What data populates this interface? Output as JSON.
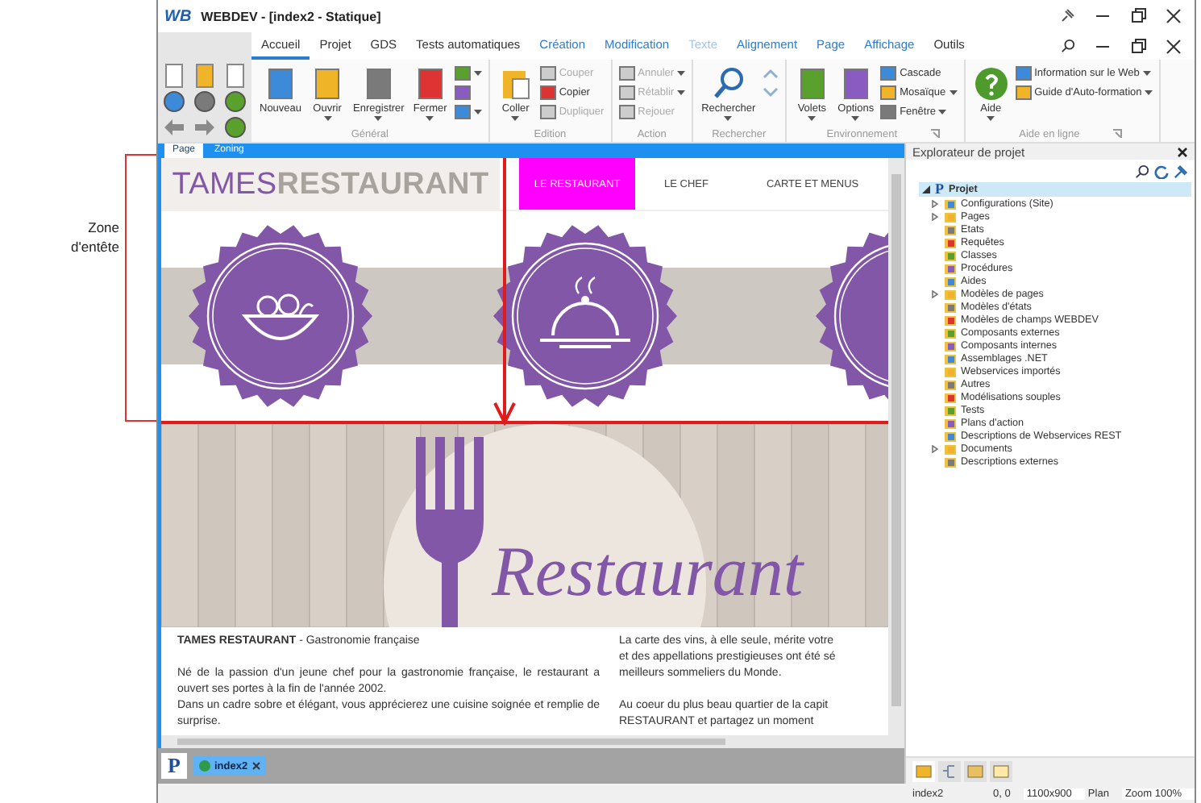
{
  "annotation": {
    "label": "Zone d'entête"
  },
  "window": {
    "logo": "WB",
    "title": "WEBDEV - [index2 - Statique]"
  },
  "ribbon_tabs": [
    {
      "label": "Accueil",
      "kind": "standard",
      "selected": true,
      "disabled": false
    },
    {
      "label": "Projet",
      "kind": "standard",
      "selected": false,
      "disabled": false
    },
    {
      "label": "GDS",
      "kind": "standard",
      "selected": false,
      "disabled": false
    },
    {
      "label": "Tests automatiques",
      "kind": "standard",
      "selected": false,
      "disabled": false
    },
    {
      "label": "Création",
      "kind": "contextual",
      "selected": false,
      "disabled": false
    },
    {
      "label": "Modification",
      "kind": "contextual",
      "selected": false,
      "disabled": false
    },
    {
      "label": "Texte",
      "kind": "contextual",
      "selected": false,
      "disabled": true
    },
    {
      "label": "Alignement",
      "kind": "contextual",
      "selected": false,
      "disabled": false
    },
    {
      "label": "Page",
      "kind": "contextual",
      "selected": false,
      "disabled": false
    },
    {
      "label": "Affichage",
      "kind": "contextual",
      "selected": false,
      "disabled": false
    },
    {
      "label": "Outils",
      "kind": "standard",
      "selected": false,
      "disabled": false
    }
  ],
  "ribbon_groups": [
    {
      "label": "Général",
      "launcher": false,
      "items": [
        {
          "kind": "large",
          "label": "Nouveau",
          "menu": false,
          "disabled": false
        },
        {
          "kind": "large",
          "label": "Ouvrir",
          "menu": true,
          "disabled": false
        },
        {
          "kind": "large",
          "label": "Enregistrer",
          "menu": true,
          "disabled": false
        },
        {
          "kind": "large",
          "label": "Fermer",
          "menu": true,
          "disabled": false
        },
        {
          "kind": "small",
          "menu": true,
          "disabled": false
        },
        {
          "kind": "small",
          "menu": false,
          "disabled": false
        },
        {
          "kind": "small",
          "menu": true,
          "disabled": false
        }
      ]
    },
    {
      "label": "Edition",
      "launcher": false,
      "items": [
        {
          "kind": "large",
          "label": "Coller",
          "menu": true,
          "disabled": false
        },
        {
          "kind": "small",
          "label": "Couper",
          "menu": false,
          "disabled": true
        },
        {
          "kind": "small",
          "label": "Copier",
          "menu": false,
          "disabled": false
        },
        {
          "kind": "small",
          "label": "Dupliquer",
          "menu": false,
          "disabled": true
        }
      ]
    },
    {
      "label": "Action",
      "launcher": false,
      "items": [
        {
          "kind": "small",
          "label": "Annuler",
          "menu": true,
          "disabled": true
        },
        {
          "kind": "small",
          "label": "Rétablir",
          "menu": true,
          "disabled": true
        },
        {
          "kind": "small",
          "label": "Rejouer",
          "menu": false,
          "disabled": true
        }
      ]
    },
    {
      "label": "Rechercher",
      "launcher": false,
      "items": [
        {
          "kind": "large",
          "label": "Rechercher",
          "menu": true,
          "disabled": false
        },
        {
          "kind": "small",
          "menu": false,
          "disabled": false
        },
        {
          "kind": "small",
          "menu": false,
          "disabled": false
        }
      ]
    },
    {
      "label": "Environnement",
      "launcher": true,
      "items": [
        {
          "kind": "large",
          "label": "Volets",
          "menu": true,
          "disabled": false
        },
        {
          "kind": "large",
          "label": "Options",
          "menu": true,
          "disabled": false
        },
        {
          "kind": "small",
          "label": "Cascade",
          "menu": false,
          "disabled": false
        },
        {
          "kind": "small",
          "label": "Mosaïque",
          "menu": true,
          "disabled": false
        },
        {
          "kind": "small",
          "label": "Fenêtre",
          "menu": true,
          "disabled": false
        }
      ]
    },
    {
      "label": "Aide en ligne",
      "launcher": true,
      "items": [
        {
          "kind": "large",
          "label": "Aide",
          "menu": true,
          "disabled": false
        },
        {
          "kind": "small",
          "label": "Information sur le Web",
          "menu": true,
          "disabled": false
        },
        {
          "kind": "small",
          "label": "Guide d'Auto-formation",
          "menu": true,
          "disabled": false
        }
      ]
    }
  ],
  "editor_tabs": [
    {
      "label": "Page",
      "selected": true
    },
    {
      "label": "Zoning",
      "selected": false
    }
  ],
  "page_preview": {
    "logo": [
      "TAMES",
      "RESTAURANT"
    ],
    "menu": [
      {
        "label": "LE RESTAURANT",
        "selected": true
      },
      {
        "label": "LE CHEF",
        "selected": false
      },
      {
        "label": "CARTE ET MENUS",
        "selected": false
      }
    ],
    "hero_title": "Restaurant",
    "column_1": [
      "**TAMES RESTAURANT** - Gastronomie française",
      "Né de la passion d'un jeune chef pour la gastronomie française, le restaurant a ouvert ses portes à la fin de l'année 2002.",
      "Dans un cadre sobre et élégant, vous apprécierez une cuisine soignée et remplie de surprise."
    ],
    "column_2": [
      {
        "lines": [
          "La carte des vins, à elle seule, mérite votre",
          "et des appellations prestigieuses ont été sé",
          "meilleurs sommeliers du Monde."
        ]
      },
      {
        "lines": [
          "Au coeur du plus beau quartier de la capit",
          "RESTAURANT et partagez un moment"
        ]
      }
    ]
  },
  "doc_tabs": {
    "project_button": "P",
    "tabs": [
      {
        "label": "index2",
        "selected": true
      }
    ]
  },
  "explorer": {
    "title": "Explorateur de projet",
    "root": {
      "icon_letter": "P",
      "label": "Projet",
      "expanded": true,
      "selected": true,
      "children": [
        {
          "label": "Configurations (Site)",
          "expandable": true
        },
        {
          "label": "Pages",
          "expandable": true
        },
        {
          "label": "Etats",
          "expandable": false
        },
        {
          "label": "Requêtes",
          "expandable": false
        },
        {
          "label": "Classes",
          "expandable": false
        },
        {
          "label": "Procédures",
          "expandable": false
        },
        {
          "label": "Aides",
          "expandable": false
        },
        {
          "label": "Modèles de pages",
          "expandable": true
        },
        {
          "label": "Modèles d'états",
          "expandable": false
        },
        {
          "label": "Modèles de champs WEBDEV",
          "expandable": false
        },
        {
          "label": "Composants externes",
          "expandable": false
        },
        {
          "label": "Composants internes",
          "expandable": false
        },
        {
          "label": "Assemblages .NET",
          "expandable": false
        },
        {
          "label": "Webservices importés",
          "expandable": false
        },
        {
          "label": "Autres",
          "expandable": false
        },
        {
          "label": "Modélisations souples",
          "expandable": false
        },
        {
          "label": "Tests",
          "expandable": false
        },
        {
          "label": "Plans d'action",
          "expandable": false
        },
        {
          "label": "Descriptions de Webservices REST",
          "expandable": false
        },
        {
          "label": "Documents",
          "expandable": true
        },
        {
          "label": "Descriptions externes",
          "expandable": false
        }
      ]
    }
  },
  "panel_tabs": [
    {
      "selected": true
    },
    {
      "selected": false
    },
    {
      "selected": false
    },
    {
      "selected": false
    }
  ],
  "status_bar": [
    "index2",
    "0, 0",
    "1100x900",
    "Plan",
    "Zoom 100%"
  ]
}
